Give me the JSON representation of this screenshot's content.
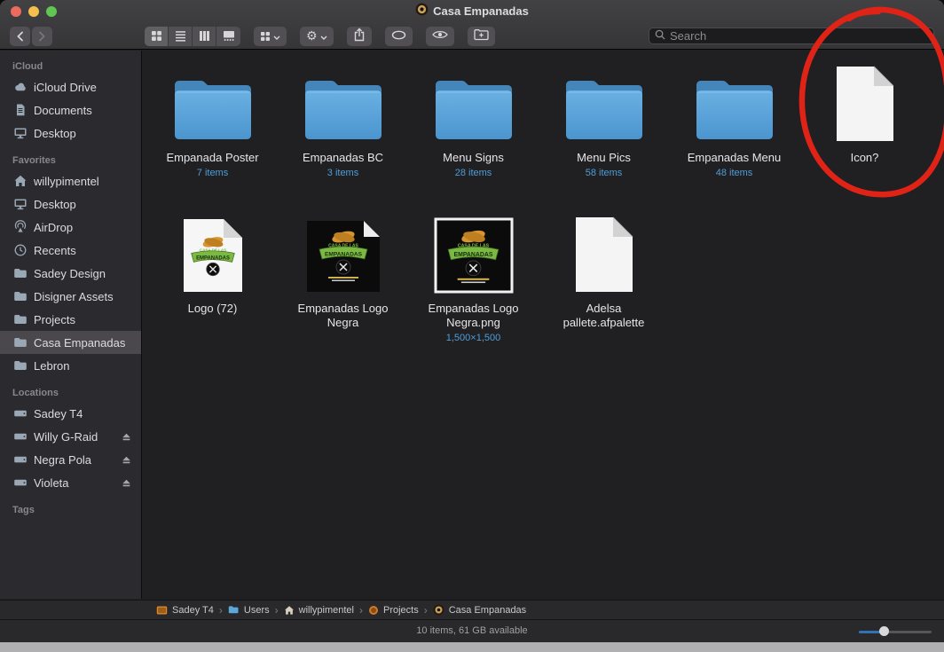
{
  "window": {
    "title": "Casa Empanadas"
  },
  "search": {
    "placeholder": "Search"
  },
  "sidebar": {
    "sections": [
      {
        "title": "iCloud",
        "items": [
          {
            "label": "iCloud Drive",
            "icon": "icloud-icon"
          },
          {
            "label": "Documents",
            "icon": "documents-icon"
          },
          {
            "label": "Desktop",
            "icon": "desktop-icon"
          }
        ]
      },
      {
        "title": "Favorites",
        "items": [
          {
            "label": "willypimentel",
            "icon": "home-icon"
          },
          {
            "label": "Desktop",
            "icon": "desktop-icon"
          },
          {
            "label": "AirDrop",
            "icon": "airdrop-icon"
          },
          {
            "label": "Recents",
            "icon": "recents-icon"
          },
          {
            "label": "Sadey Design",
            "icon": "folder-icon"
          },
          {
            "label": "Disigner Assets",
            "icon": "folder-icon"
          },
          {
            "label": "Projects",
            "icon": "folder-icon"
          },
          {
            "label": "Casa Empanadas",
            "icon": "folder-icon",
            "selected": true
          },
          {
            "label": "Lebron",
            "icon": "folder-icon"
          }
        ]
      },
      {
        "title": "Locations",
        "items": [
          {
            "label": "Sadey T4",
            "icon": "drive-icon"
          },
          {
            "label": "Willy G-Raid",
            "icon": "drive-icon",
            "eject": true
          },
          {
            "label": "Negra Pola",
            "icon": "drive-icon",
            "eject": true
          },
          {
            "label": "Violeta",
            "icon": "drive-icon",
            "eject": true
          }
        ]
      },
      {
        "title": "Tags",
        "items": []
      }
    ]
  },
  "files": [
    {
      "name": "Empanada Poster",
      "info": "7 items",
      "kind": "folder"
    },
    {
      "name": "Empanadas BC",
      "info": "3 items",
      "kind": "folder"
    },
    {
      "name": "Menu Signs",
      "info": "28 items",
      "kind": "folder"
    },
    {
      "name": "Menu Pics",
      "info": "58 items",
      "kind": "folder"
    },
    {
      "name": "Empanadas Menu",
      "info": "48 items",
      "kind": "folder"
    },
    {
      "name": "Icon?",
      "info": "",
      "kind": "document"
    },
    {
      "name": "Logo (72)",
      "info": "",
      "kind": "image-light"
    },
    {
      "name": "Empanadas Logo Negra",
      "info": "",
      "kind": "image-dark"
    },
    {
      "name": "Empanadas Logo Negra.png",
      "info": "1,500×1,500",
      "kind": "image-dark-framed"
    },
    {
      "name": "Adelsa pallete.afpalette",
      "info": "",
      "kind": "document"
    }
  ],
  "path_bar": [
    {
      "label": "Sadey T4",
      "icon": "drive-orange-icon"
    },
    {
      "label": "Users",
      "icon": "folder-small-icon"
    },
    {
      "label": "willypimentel",
      "icon": "home-small-icon"
    },
    {
      "label": "Projects",
      "icon": "projects-small-icon"
    },
    {
      "label": "Casa Empanadas",
      "icon": "logo-small-icon"
    }
  ],
  "status_bar": {
    "text": "10 items, 61 GB available"
  },
  "annotation": {
    "type": "hand-drawn-circle",
    "around": "Icon?",
    "color": "#df2317"
  },
  "colors": {
    "folder_blue": "#58a7dc",
    "info_blue": "#4f9ed9",
    "accent_blue": "#3071b8"
  }
}
